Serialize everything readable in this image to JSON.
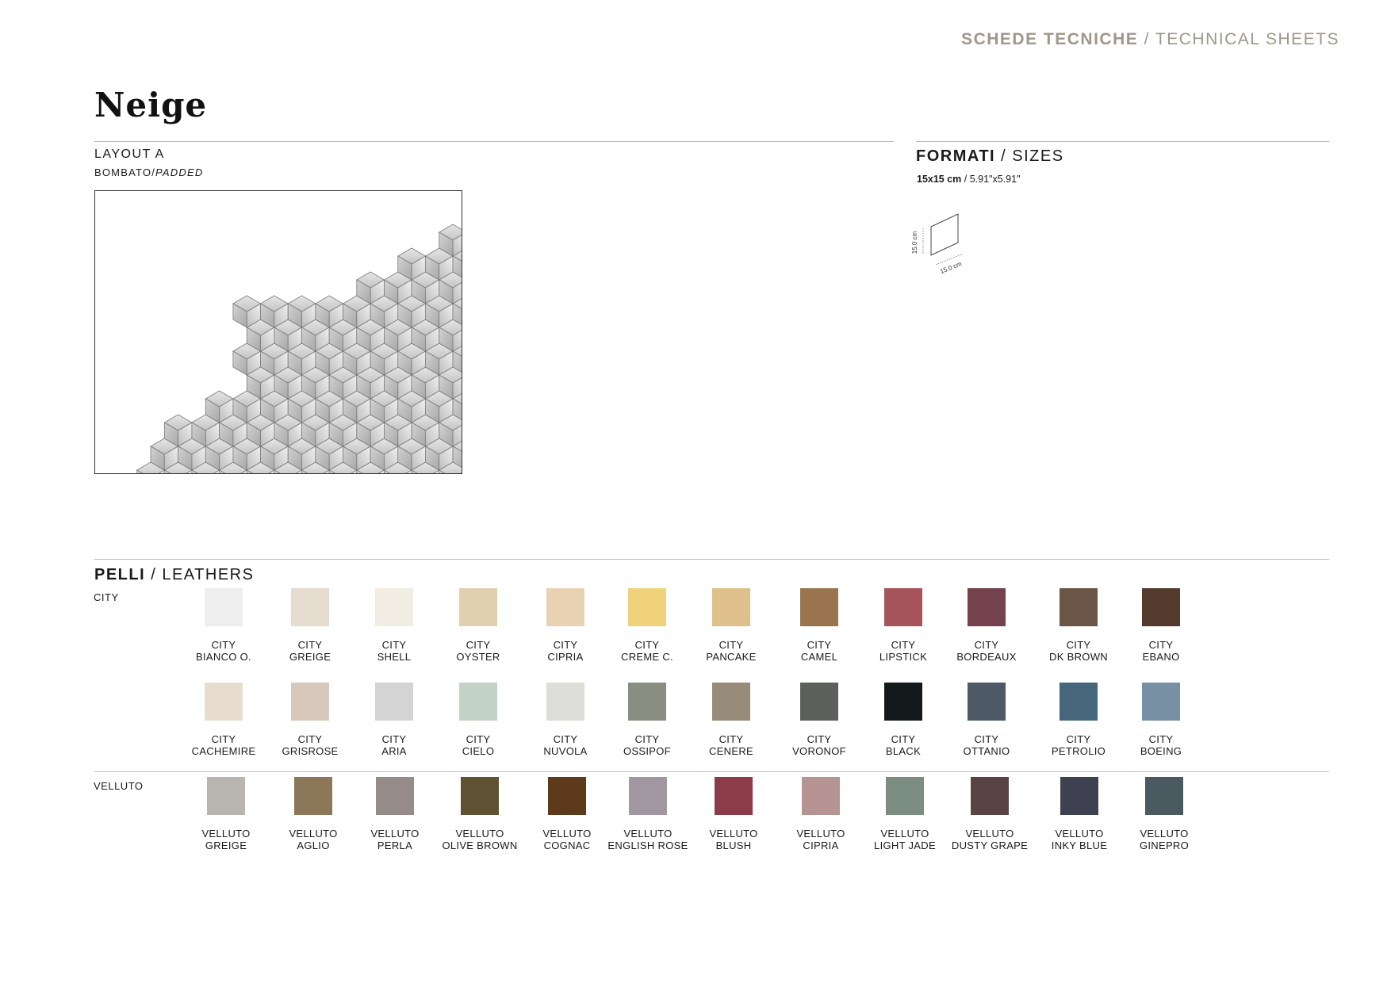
{
  "header": {
    "title_strong": "SCHEDE TECNICHE",
    "title_rest": " / TECHNICAL SHEETS"
  },
  "product": {
    "name": "Neige"
  },
  "layout": {
    "title": "LAYOUT A",
    "sub_strong": "BOMBATO/",
    "sub_italic": "PADDED"
  },
  "sizes": {
    "title_strong": "FORMATI",
    "title_rest": " / SIZES",
    "size_cm": "15x15 cm",
    "size_in": " / 5.91\"x5.91\"",
    "dim_h": "15.0 cm",
    "dim_w": "15.0 cm"
  },
  "leathers": {
    "title_strong": "PELLI",
    "title_rest": " / LEATHERS",
    "groups": [
      {
        "label": "CITY",
        "swatches": [
          {
            "line1": "CITY",
            "line2": "BIANCO O.",
            "color": "#eeeeee"
          },
          {
            "line1": "CITY",
            "line2": "GREIGE",
            "color": "#e6dcd0"
          },
          {
            "line1": "CITY",
            "line2": "SHELL",
            "color": "#f1ede2"
          },
          {
            "line1": "CITY",
            "line2": "OYSTER",
            "color": "#e0d0b0"
          },
          {
            "line1": "CITY",
            "line2": "CIPRIA",
            "color": "#e9d2b3"
          },
          {
            "line1": "CITY",
            "line2": "CREME C.",
            "color": "#efd27a"
          },
          {
            "line1": "CITY",
            "line2": "PANCAKE",
            "color": "#dfbf8a"
          },
          {
            "line1": "CITY",
            "line2": "CAMEL",
            "color": "#9a744e"
          },
          {
            "line1": "CITY",
            "line2": "LIPSTICK",
            "color": "#a5545a"
          },
          {
            "line1": "CITY",
            "line2": "BORDEAUX",
            "color": "#73424d"
          },
          {
            "line1": "CITY",
            "line2": "DK BROWN",
            "color": "#6b5546"
          },
          {
            "line1": "CITY",
            "line2": "EBANO",
            "color": "#533a2c"
          },
          {
            "line1": "CITY",
            "line2": "CACHEMIRE",
            "color": "#e7dccd"
          },
          {
            "line1": "CITY",
            "line2": "GRISROSE",
            "color": "#d8c8bc"
          },
          {
            "line1": "CITY",
            "line2": "ARIA",
            "color": "#d4d4d4"
          },
          {
            "line1": "CITY",
            "line2": "CIELO",
            "color": "#c3d2c7"
          },
          {
            "line1": "CITY",
            "line2": "NUVOLA",
            "color": "#dcdcd8"
          },
          {
            "line1": "CITY",
            "line2": "OSSIPOF",
            "color": "#8a8e82"
          },
          {
            "line1": "CITY",
            "line2": "CENERE",
            "color": "#978b7a"
          },
          {
            "line1": "CITY",
            "line2": "VORONOF",
            "color": "#5c5f5b"
          },
          {
            "line1": "CITY",
            "line2": "BLACK",
            "color": "#141a1b"
          },
          {
            "line1": "CITY",
            "line2": "OTTANIO",
            "color": "#4d5a66"
          },
          {
            "line1": "CITY",
            "line2": "PETROLIO",
            "color": "#46667b"
          },
          {
            "line1": "CITY",
            "line2": "BOEING",
            "color": "#7890a3"
          }
        ]
      },
      {
        "label": "VELLUTO",
        "swatches": [
          {
            "line1": "VELLUTO",
            "line2": "GREIGE",
            "color": "#b8b4ae"
          },
          {
            "line1": "VELLUTO",
            "line2": "AGLIO",
            "color": "#8c7758"
          },
          {
            "line1": "VELLUTO",
            "line2": "PERLA",
            "color": "#958c8a"
          },
          {
            "line1": "VELLUTO",
            "line2": "OLIVE BROWN",
            "color": "#5e5233"
          },
          {
            "line1": "VELLUTO",
            "line2": "COGNAC",
            "color": "#5e3a1c"
          },
          {
            "line1": "VELLUTO",
            "line2": "ENGLISH ROSE",
            "color": "#a197a0"
          },
          {
            "line1": "VELLUTO",
            "line2": "BLUSH",
            "color": "#8c3c48"
          },
          {
            "line1": "VELLUTO",
            "line2": "CIPRIA",
            "color": "#b79494"
          },
          {
            "line1": "VELLUTO",
            "line2": "LIGHT JADE",
            "color": "#7b8c82"
          },
          {
            "line1": "VELLUTO",
            "line2": "DUSTY GRAPE",
            "color": "#5a4343"
          },
          {
            "line1": "VELLUTO",
            "line2": "INKY BLUE",
            "color": "#3f4150"
          },
          {
            "line1": "VELLUTO",
            "line2": "GINEPRO",
            "color": "#4b5a60"
          }
        ]
      }
    ]
  }
}
